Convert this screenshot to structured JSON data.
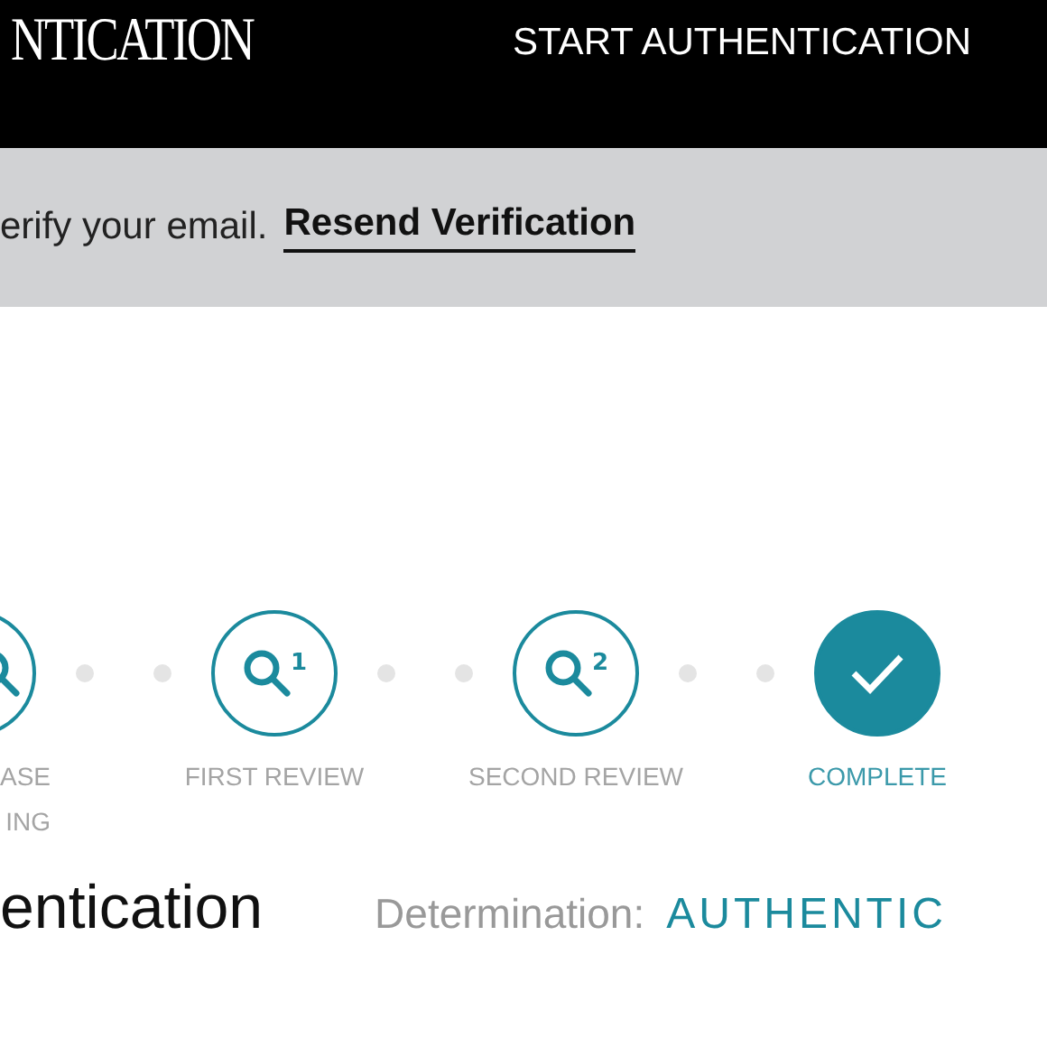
{
  "header": {
    "logo": "NTICATION",
    "nav_link": "START AUTHENTICATION"
  },
  "banner": {
    "message": "erify your email.",
    "link": "Resend Verification"
  },
  "steps": [
    {
      "kind": "search",
      "label_lines": [
        "ASE",
        "ING"
      ],
      "done": false
    },
    {
      "kind": "search",
      "number": "1",
      "label_lines": [
        "FIRST REVIEW"
      ],
      "done": false
    },
    {
      "kind": "search",
      "number": "2",
      "label_lines": [
        "SECOND REVIEW"
      ],
      "done": false
    },
    {
      "kind": "check",
      "label_lines": [
        "COMPLETE"
      ],
      "done": true
    }
  ],
  "result": {
    "title": "entication",
    "label": "Determination:",
    "value": "AUTHENTIC"
  }
}
